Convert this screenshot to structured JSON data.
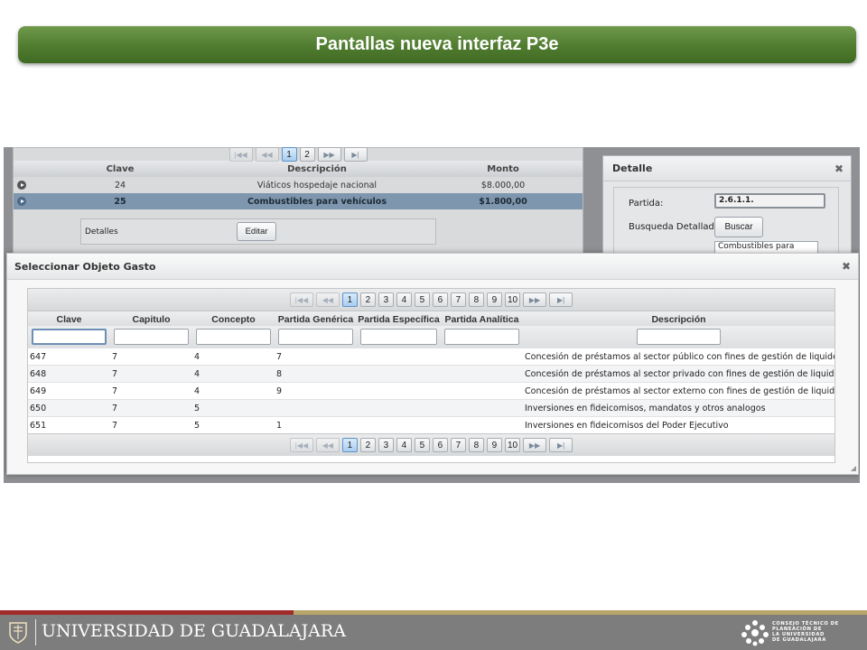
{
  "slide_title": "Pantallas nueva interfaz P3e",
  "background_grid": {
    "pages": [
      "1",
      "2"
    ],
    "active_page": "1",
    "columns": [
      "Clave",
      "Descripción",
      "Monto"
    ],
    "rows": [
      {
        "clave": "24",
        "descripcion": "Viáticos hospedaje nacional",
        "monto": "$8.000,00"
      },
      {
        "clave": "25",
        "descripcion": "Combustibles para vehículos",
        "monto": "$1.800,00"
      }
    ],
    "detalles_label": "Detalles",
    "editar_label": "Editar"
  },
  "detalle_panel": {
    "title": "Detalle",
    "partida_label": "Partida:",
    "partida_value": "2.6.1.1.",
    "busqueda_label": "Busqueda Detallada",
    "buscar_label": "Buscar",
    "descripcion_value": "Combustibles para"
  },
  "dialog": {
    "title": "Seleccionar Objeto Gasto",
    "pager": {
      "first": "|◀◀",
      "prev": "◀◀",
      "next": "▶▶",
      "last": "▶|",
      "pages": [
        "1",
        "2",
        "3",
        "4",
        "5",
        "6",
        "7",
        "8",
        "9",
        "10"
      ],
      "active_page": "1"
    },
    "columns": [
      "Clave",
      "Capitulo",
      "Concepto",
      "Partida Genérica",
      "Partida Específica",
      "Partida Analítica",
      "Descripción"
    ],
    "rows": [
      {
        "clave": "647",
        "capitulo": "7",
        "concepto": "4",
        "generica": "7",
        "especifica": "",
        "analitica": "",
        "descripcion": "Concesión de préstamos al sector público con fines de gestión de liquidez"
      },
      {
        "clave": "648",
        "capitulo": "7",
        "concepto": "4",
        "generica": "8",
        "especifica": "",
        "analitica": "",
        "descripcion": "Concesión de préstamos al sector privado con fines de gestión de liquidez"
      },
      {
        "clave": "649",
        "capitulo": "7",
        "concepto": "4",
        "generica": "9",
        "especifica": "",
        "analitica": "",
        "descripcion": "Concesión de préstamos al sector externo con fines de gestión de liquidez"
      },
      {
        "clave": "650",
        "capitulo": "7",
        "concepto": "5",
        "generica": "",
        "especifica": "",
        "analitica": "",
        "descripcion": "Inversiones en fideicomisos, mandatos y otros analogos"
      },
      {
        "clave": "651",
        "capitulo": "7",
        "concepto": "5",
        "generica": "1",
        "especifica": "",
        "analitica": "",
        "descripcion": "Inversiones en fideicomisos del Poder Ejecutivo"
      }
    ]
  },
  "footer": {
    "university_name": "UNIVERSIDAD DE GUADALAJARA",
    "council_lines": [
      "CONSEJO TÉCNICO DE",
      "PLANEACIÓN DE",
      "LA UNIVERSIDAD",
      "DE GUADALAJARA"
    ],
    "colors": {
      "red": "#a12a2a",
      "gold": "#b7a56b",
      "gray": "#7d7d7d",
      "banner_green": "#507c30"
    }
  }
}
